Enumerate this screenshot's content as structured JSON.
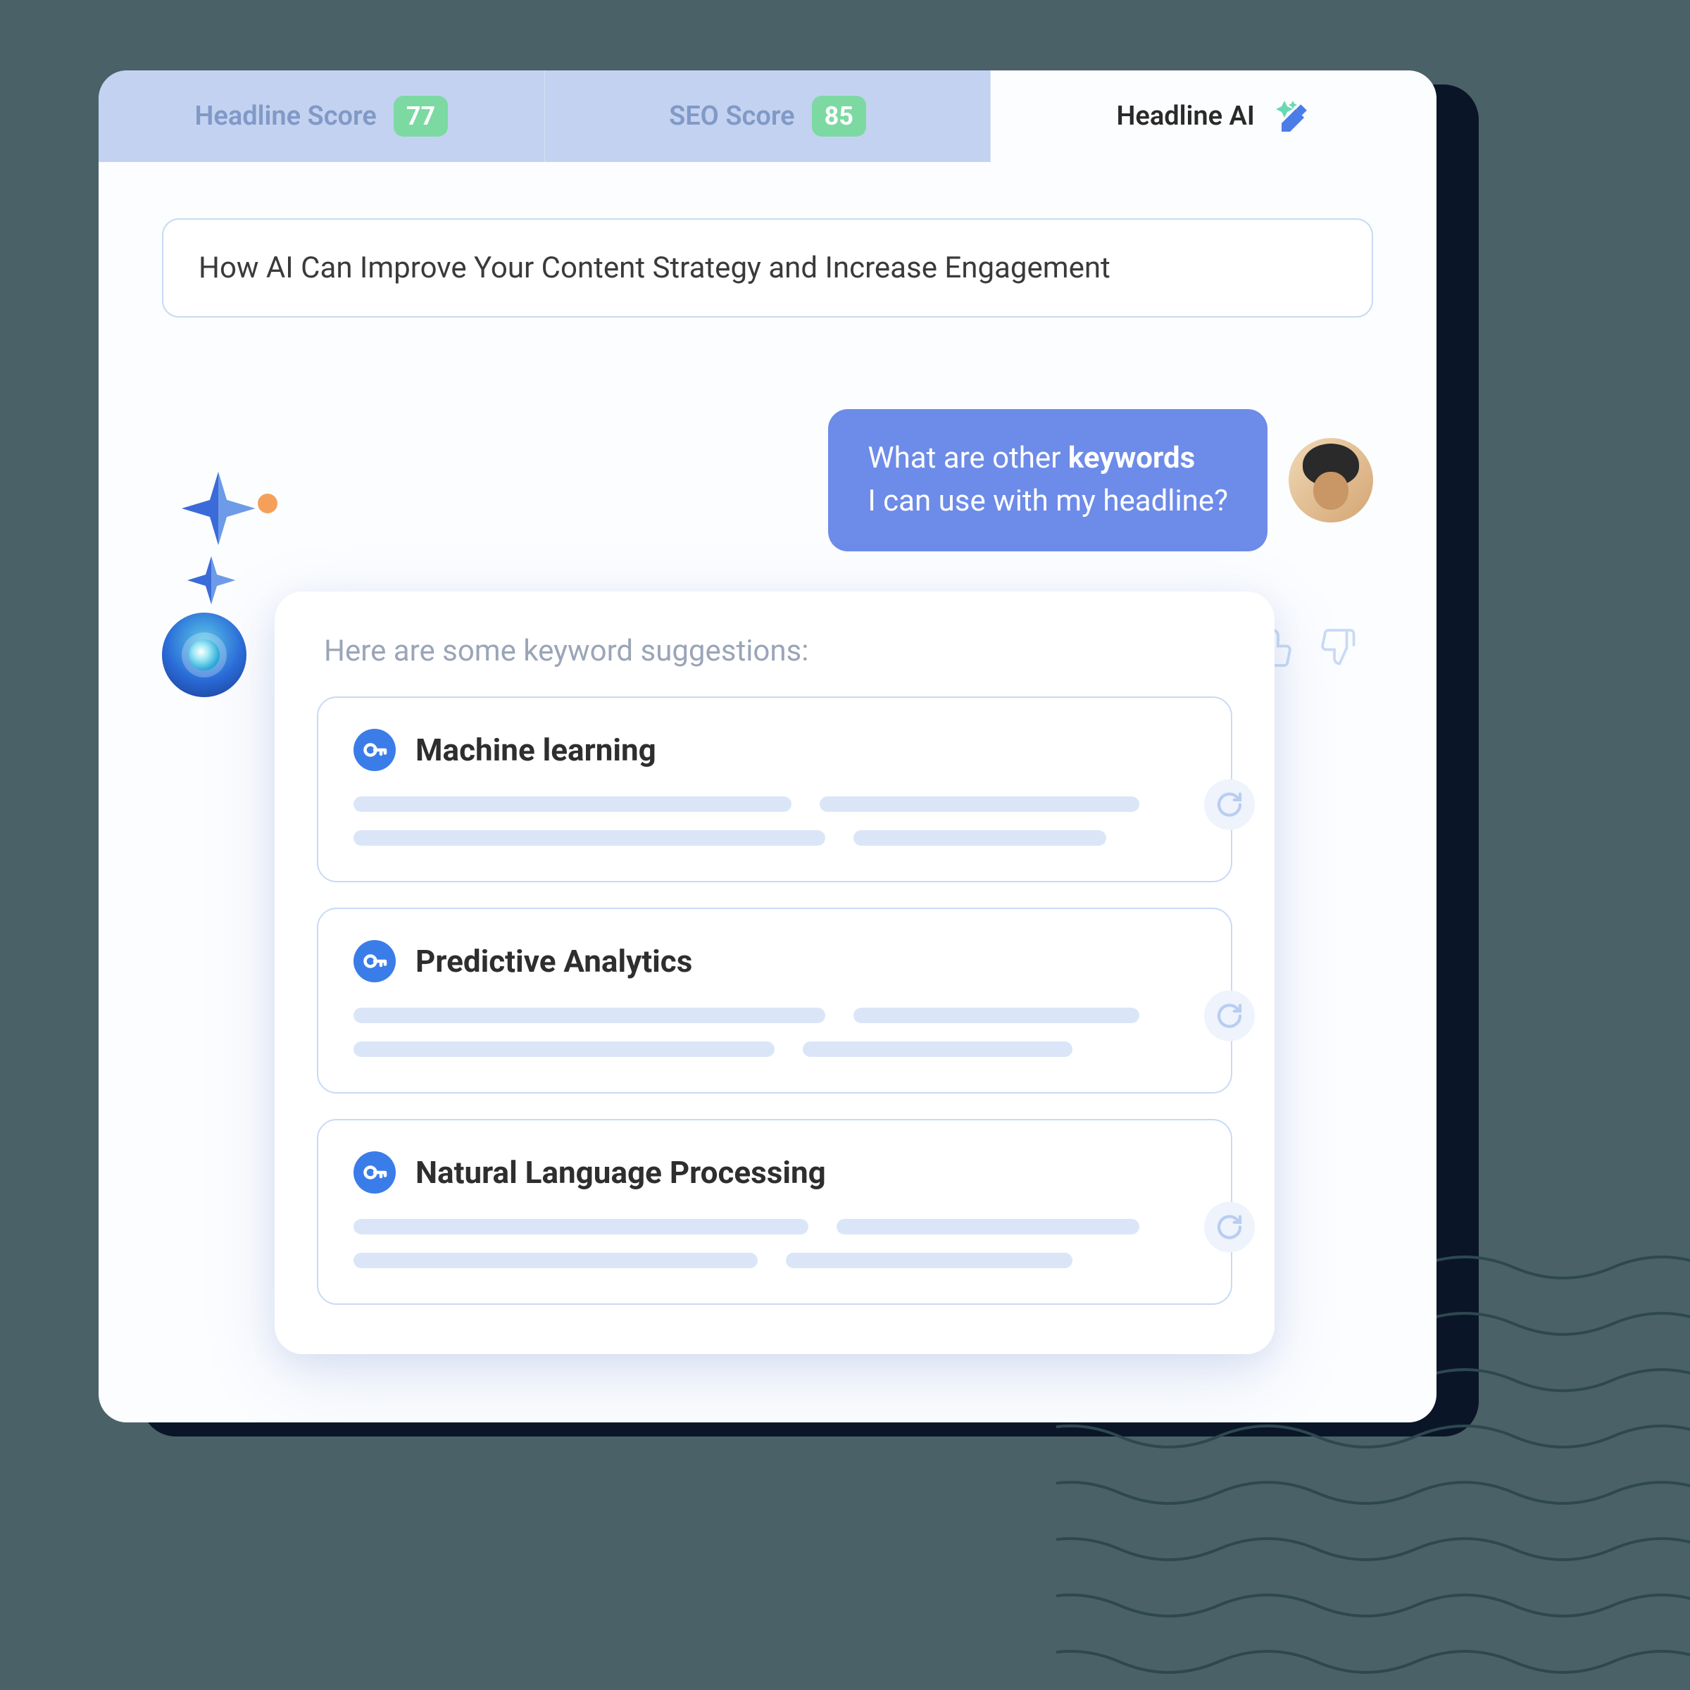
{
  "tabs": [
    {
      "label": "Headline Score",
      "score": "77"
    },
    {
      "label": "SEO Score",
      "score": "85"
    },
    {
      "label": "Headline AI"
    }
  ],
  "headline_input": "How AI Can Improve Your Content Strategy and Increase Engagement",
  "user_message": {
    "prefix": "What are other ",
    "bold": "keywords",
    "suffix": " I can use with my headline?"
  },
  "response_title": "Here are some keyword suggestions:",
  "keywords": [
    {
      "title": "Machine learning"
    },
    {
      "title": "Predictive Analytics"
    },
    {
      "title": "Natural Language Processing"
    }
  ],
  "colors": {
    "accent": "#6d8be8",
    "badge": "#7cd9a2",
    "icon_blue": "#3a7de8"
  }
}
